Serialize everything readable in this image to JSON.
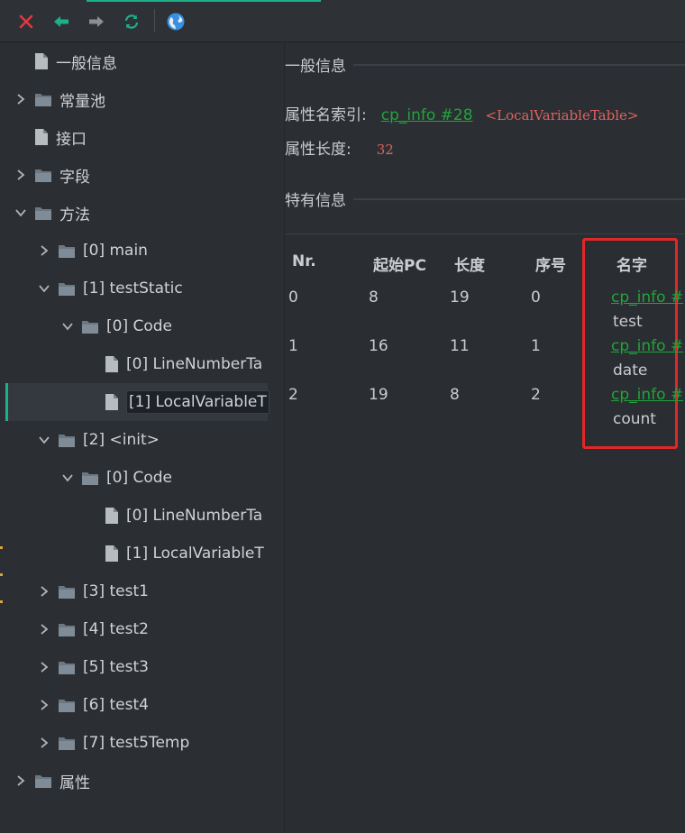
{
  "toolbar": {
    "buttons": [
      {
        "icon": "close-icon"
      },
      {
        "icon": "back-arrow-icon"
      },
      {
        "icon": "forward-arrow-icon"
      },
      {
        "icon": "refresh-icon"
      },
      {
        "icon": "globe-icon"
      }
    ],
    "colors": {
      "close": "#e0383f",
      "back": "#1db08a",
      "forward": "#8a8f94",
      "refresh": "#1db08a",
      "globe": "#3b8fe0"
    }
  },
  "tree": {
    "items": [
      {
        "label": "一般信息",
        "level": 0,
        "type": "file",
        "expand": "none"
      },
      {
        "label": "常量池",
        "level": 0,
        "type": "folder",
        "expand": "collapsed"
      },
      {
        "label": "接口",
        "level": 0,
        "type": "file",
        "expand": "none"
      },
      {
        "label": "字段",
        "level": 0,
        "type": "folder",
        "expand": "collapsed"
      },
      {
        "label": "方法",
        "level": 0,
        "type": "folder",
        "expand": "expanded"
      },
      {
        "label": "[0] main",
        "level": 1,
        "type": "folder",
        "expand": "collapsed"
      },
      {
        "label": "[1] testStatic",
        "level": 1,
        "type": "folder",
        "expand": "expanded"
      },
      {
        "label": "[0] Code",
        "level": 2,
        "type": "folder",
        "expand": "expanded"
      },
      {
        "label": "[0] LineNumberTa",
        "level": 3,
        "type": "file",
        "expand": "none"
      },
      {
        "label": "[1] LocalVariableT",
        "level": 3,
        "type": "file",
        "expand": "none",
        "selected": true
      },
      {
        "label": "[2] <init>",
        "level": 1,
        "type": "folder",
        "expand": "expanded"
      },
      {
        "label": "[0] Code",
        "level": 2,
        "type": "folder",
        "expand": "expanded"
      },
      {
        "label": "[0] LineNumberTa",
        "level": 3,
        "type": "file",
        "expand": "none"
      },
      {
        "label": "[1] LocalVariableT",
        "level": 3,
        "type": "file",
        "expand": "none"
      },
      {
        "label": "[3] test1",
        "level": 1,
        "type": "folder",
        "expand": "collapsed"
      },
      {
        "label": "[4] test2",
        "level": 1,
        "type": "folder",
        "expand": "collapsed"
      },
      {
        "label": "[5] test3",
        "level": 1,
        "type": "folder",
        "expand": "collapsed"
      },
      {
        "label": "[6] test4",
        "level": 1,
        "type": "folder",
        "expand": "collapsed"
      },
      {
        "label": "[7] test5Temp",
        "level": 1,
        "type": "folder",
        "expand": "collapsed"
      },
      {
        "label": "属性",
        "level": 0,
        "type": "folder",
        "expand": "collapsed"
      }
    ]
  },
  "main": {
    "general_info_title": "一般信息",
    "attr_name_index_label": "属性名索引:",
    "attr_name_index_link": "cp_info #28",
    "attr_name_value": "<LocalVariableTable>",
    "attr_length_label": "属性长度:",
    "attr_length_value": "32",
    "specific_info_title": "特有信息",
    "table": {
      "headers": [
        "Nr.",
        "起始PC",
        "长度",
        "序号",
        "名字"
      ],
      "rows": [
        {
          "nr": "0",
          "start_pc": "8",
          "length": "19",
          "index": "0",
          "name_link": "cp_info #",
          "name": "test"
        },
        {
          "nr": "1",
          "start_pc": "16",
          "length": "11",
          "index": "1",
          "name_link": "cp_info #",
          "name": "date"
        },
        {
          "nr": "2",
          "start_pc": "19",
          "length": "8",
          "index": "2",
          "name_link": "cp_info #",
          "name": "count"
        }
      ]
    }
  }
}
